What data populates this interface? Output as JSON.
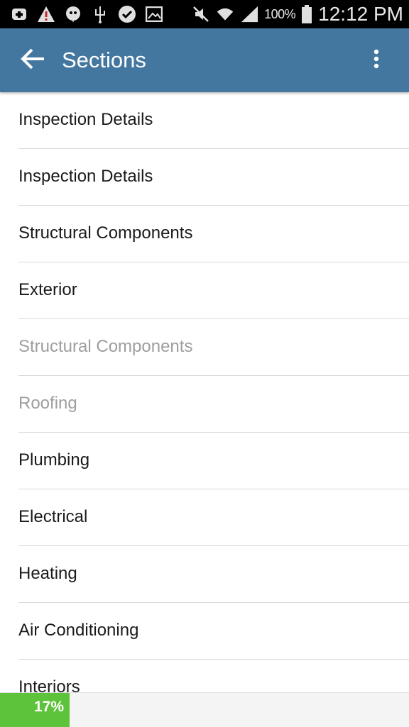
{
  "status_bar": {
    "icons": [
      "add-box-icon",
      "warning-icon",
      "chat-bubble-icon",
      "usb-icon",
      "heart-check-icon",
      "image-icon",
      "mute-icon",
      "wifi-icon",
      "signal-icon",
      "battery-icon"
    ],
    "battery": "100%",
    "time": "12:12 PM"
  },
  "app_bar": {
    "title": "Sections",
    "background": "#44779f"
  },
  "sections": [
    {
      "label": "Inspection Details",
      "enabled": true
    },
    {
      "label": "Inspection Details",
      "enabled": true
    },
    {
      "label": "Structural Components",
      "enabled": true
    },
    {
      "label": "Exterior",
      "enabled": true
    },
    {
      "label": "Structural Components",
      "enabled": false
    },
    {
      "label": "Roofing",
      "enabled": false
    },
    {
      "label": "Plumbing",
      "enabled": true
    },
    {
      "label": "Electrical",
      "enabled": true
    },
    {
      "label": "Heating",
      "enabled": true
    },
    {
      "label": "Air Conditioning",
      "enabled": true
    },
    {
      "label": "Interiors",
      "enabled": true
    }
  ],
  "progress": {
    "label": "17%",
    "value": 0.17,
    "color": "#5cc33b"
  }
}
